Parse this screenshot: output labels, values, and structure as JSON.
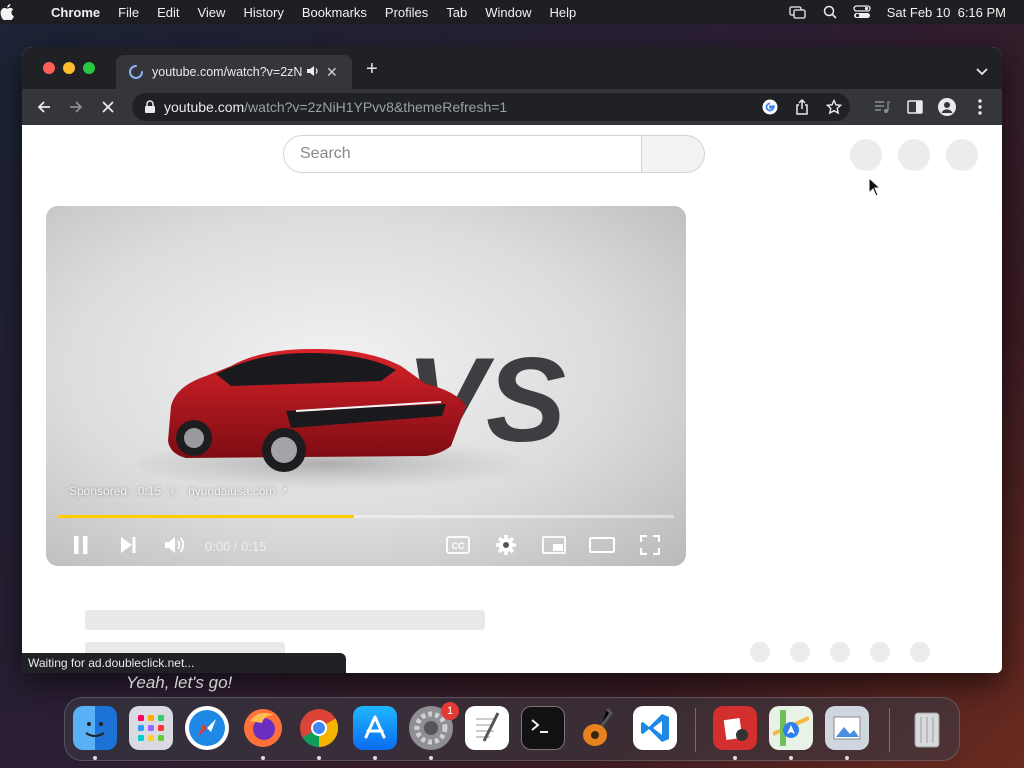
{
  "menubar": {
    "apple_icon": "apple-icon",
    "app_name": "Chrome",
    "items": [
      "File",
      "Edit",
      "View",
      "History",
      "Bookmarks",
      "Profiles",
      "Tab",
      "Window",
      "Help"
    ],
    "clock": "Sat Feb 10  6:16 PM"
  },
  "browser": {
    "tab_title": "youtube.com/watch?v=2zN",
    "url_domain": "youtube.com",
    "url_path": "/watch?v=2zNiH1YPvv8&themeRefresh=1",
    "status_text": "Waiting for ad.doubleclick.net..."
  },
  "youtube": {
    "search_placeholder": "Search"
  },
  "player": {
    "sponsored": "Sponsored · 0:15",
    "advertiser": "hyundaiusa.com",
    "time": "0:00 / 0:15",
    "progress": 0.48,
    "cc_label": "CC",
    "vs_text": "VS"
  },
  "subtitle": "Yeah, let's go!",
  "dock": {
    "apps": [
      "Finder",
      "Launchpad",
      "Safari",
      "Firefox",
      "Chrome",
      "App Store",
      "System Settings",
      "TextEdit",
      "Terminal",
      "GarageBand",
      "Visual Studio Code",
      "Photo Booth",
      "Maps",
      "Preview",
      "Trash"
    ],
    "settings_badge": "1"
  },
  "colors": {
    "progress": "#ffcc00",
    "chrome_dark": "#35363a",
    "tabstrip": "#202124"
  }
}
